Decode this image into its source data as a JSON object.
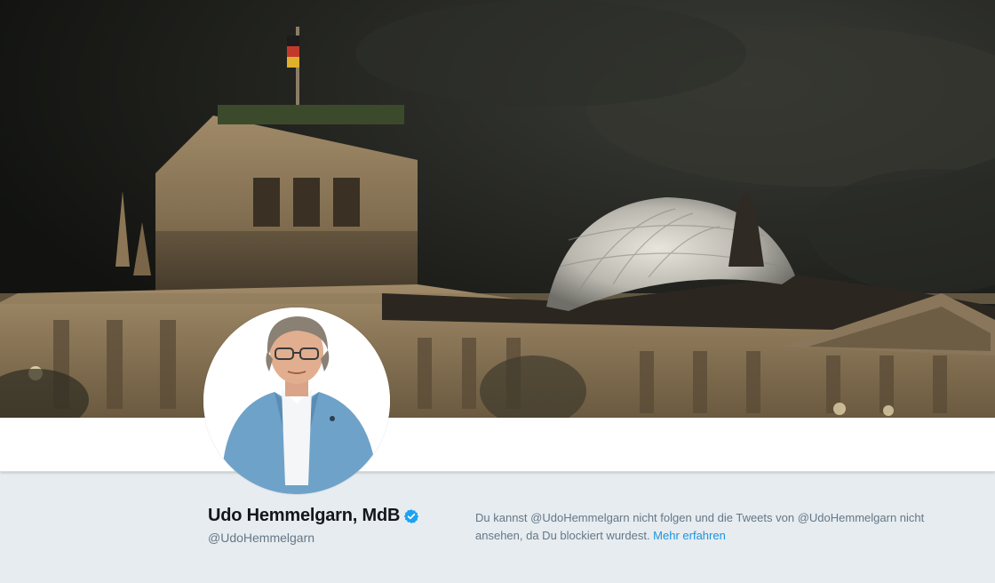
{
  "profile": {
    "display_name": "Udo Hemmelgarn, MdB",
    "handle": "@UdoHemmelgarn",
    "verified": true
  },
  "blocked_notice": {
    "message": "Du kannst @UdoHemmelgarn nicht folgen und die Tweets von @UdoHemmelgarn nicht ansehen, da Du blockiert wurdest.",
    "link_label": "Mehr erfahren"
  },
  "icons": {
    "verified": "verified-badge-icon"
  },
  "colors": {
    "link": "#1b95e0",
    "verified_badge": "#1da1f2",
    "name_text": "#14171a",
    "muted_text": "#657786",
    "page_background": "#e6ecf0",
    "nav_background": "#ffffff"
  }
}
